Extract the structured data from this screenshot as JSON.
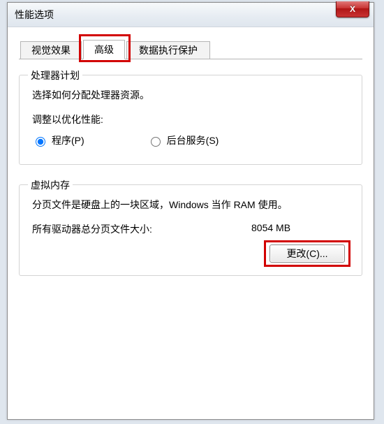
{
  "window": {
    "title": "性能选项"
  },
  "tabs": [
    {
      "label": "视觉效果"
    },
    {
      "label": "高级"
    },
    {
      "label": "数据执行保护"
    }
  ],
  "active_tab_index": 1,
  "scheduler": {
    "legend": "处理器计划",
    "desc": "选择如何分配处理器资源。",
    "subhead": "调整以优化性能:",
    "radio_programs": "程序(P)",
    "radio_services": "后台服务(S)"
  },
  "vm": {
    "legend": "虚拟内存",
    "desc": "分页文件是硬盘上的一块区域，Windows 当作 RAM 使用。",
    "total_label": "所有驱动器总分页文件大小:",
    "total_value": "8054 MB",
    "change_btn": "更改(C)..."
  },
  "close_glyph": "X"
}
